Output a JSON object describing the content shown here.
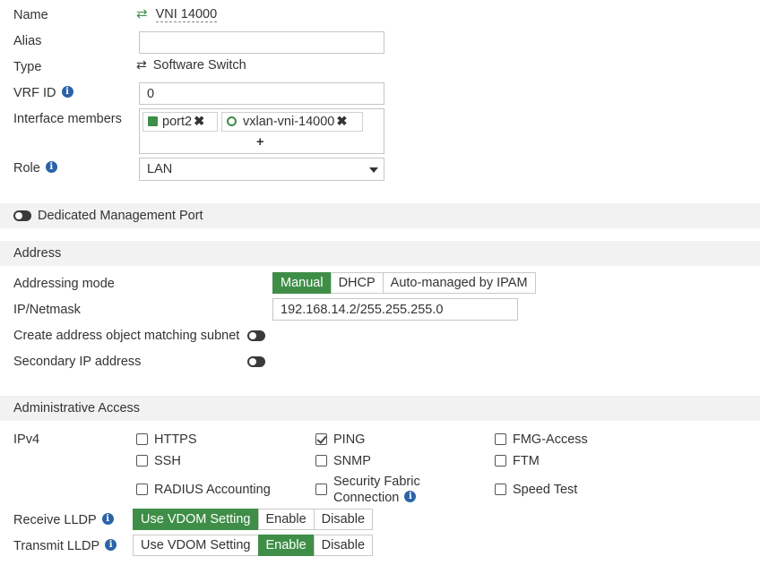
{
  "form": {
    "name_label": "Name",
    "name_value": "VNI 14000",
    "alias_label": "Alias",
    "alias_value": "",
    "type_label": "Type",
    "type_value": "Software Switch",
    "vrf_label": "VRF ID",
    "vrf_value": "0",
    "members_label": "Interface members",
    "members": [
      {
        "label": "port2",
        "icon": "port-icon"
      },
      {
        "label": "vxlan-vni-14000",
        "icon": "vxlan-icon"
      }
    ],
    "add_label": "+",
    "role_label": "Role",
    "role_value": "LAN"
  },
  "mgmt": {
    "label": "Dedicated Management Port",
    "enabled": false
  },
  "address": {
    "section_title": "Address",
    "mode_label": "Addressing mode",
    "modes": [
      "Manual",
      "DHCP",
      "Auto-managed by IPAM"
    ],
    "mode_selected": "Manual",
    "ip_label": "IP/Netmask",
    "ip_value": "192.168.14.2/255.255.255.0",
    "create_obj_label": "Create address object matching subnet",
    "create_obj_enabled": false,
    "secondary_label": "Secondary IP address",
    "secondary_enabled": false
  },
  "access": {
    "section_title": "Administrative Access",
    "ipv4_label": "IPv4",
    "options": [
      {
        "label": "HTTPS",
        "checked": false
      },
      {
        "label": "PING",
        "checked": true
      },
      {
        "label": "FMG-Access",
        "checked": false
      },
      {
        "label": "SSH",
        "checked": false
      },
      {
        "label": "SNMP",
        "checked": false
      },
      {
        "label": "FTM",
        "checked": false
      },
      {
        "label": "RADIUS Accounting",
        "checked": false
      },
      {
        "label_line1": "Security Fabric",
        "label_line2": "Connection",
        "checked": false
      },
      {
        "label": "Speed Test",
        "checked": false
      }
    ],
    "receive_lldp_label": "Receive LLDP",
    "receive_lldp_options": [
      "Use VDOM Setting",
      "Enable",
      "Disable"
    ],
    "receive_lldp_selected": "Use VDOM Setting",
    "transmit_lldp_label": "Transmit LLDP",
    "transmit_lldp_options": [
      "Use VDOM Setting",
      "Enable",
      "Disable"
    ],
    "transmit_lldp_selected": "Enable"
  },
  "colors": {
    "accent_green": "#3e8e47",
    "info_blue": "#2b63a8",
    "section_bg": "#f2f2f2"
  }
}
